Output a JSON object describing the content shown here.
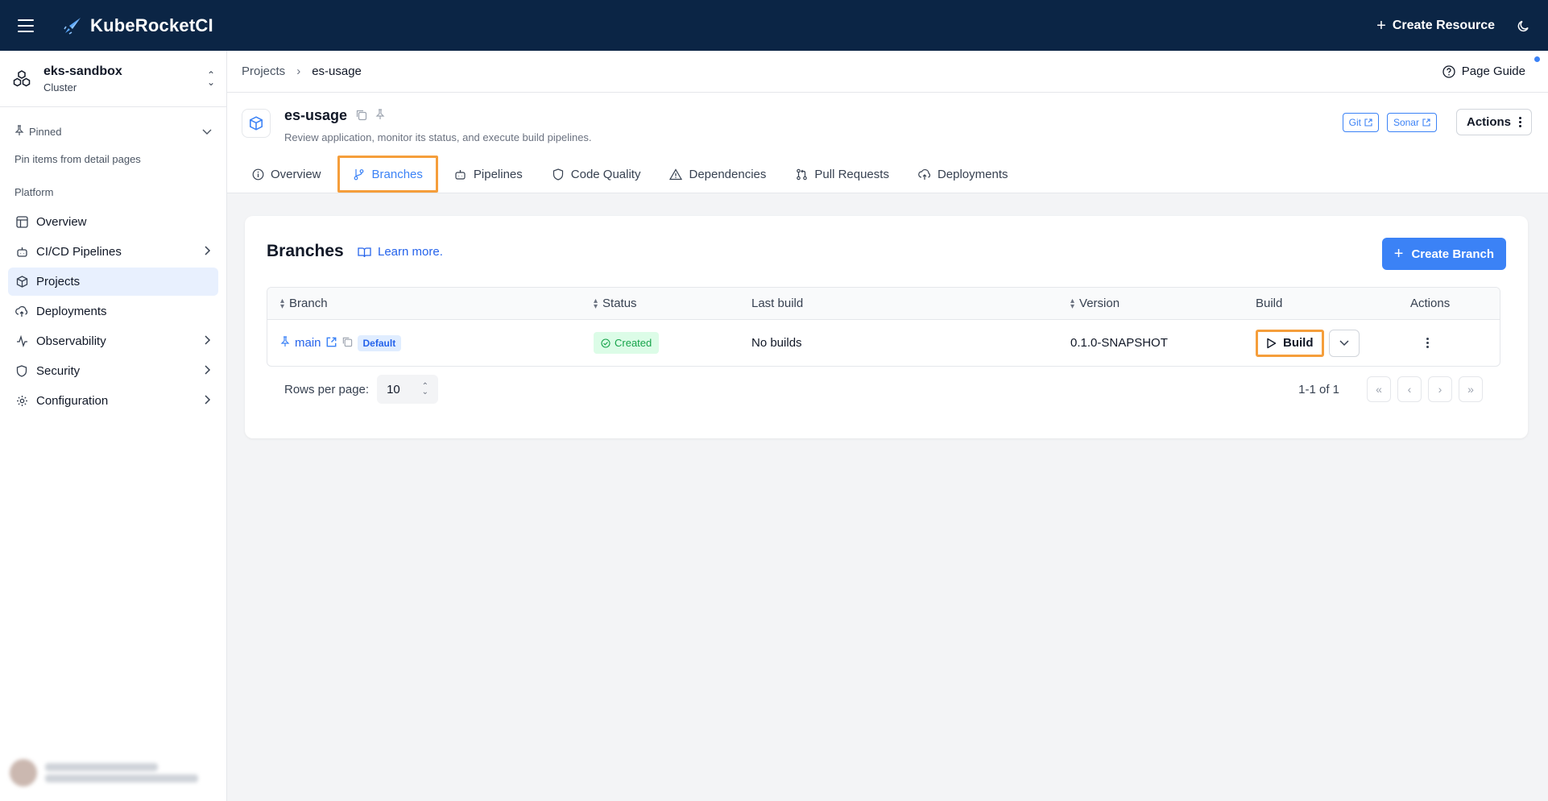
{
  "app": {
    "title": "KubeRocketCI",
    "create_resource": "Create Resource"
  },
  "sidebar": {
    "cluster_name": "eks-sandbox",
    "cluster_type": "Cluster",
    "pinned_label": "Pinned",
    "pinned_hint": "Pin items from detail pages",
    "section_label": "Platform",
    "items": [
      {
        "label": "Overview",
        "icon": "layout-icon",
        "has_children": false,
        "active": false
      },
      {
        "label": "CI/CD Pipelines",
        "icon": "bot-icon",
        "has_children": true,
        "active": false
      },
      {
        "label": "Projects",
        "icon": "box-icon",
        "has_children": false,
        "active": true
      },
      {
        "label": "Deployments",
        "icon": "cloud-upload-icon",
        "has_children": false,
        "active": false
      },
      {
        "label": "Observability",
        "icon": "activity-icon",
        "has_children": true,
        "active": false
      },
      {
        "label": "Security",
        "icon": "shield-icon",
        "has_children": true,
        "active": false
      },
      {
        "label": "Configuration",
        "icon": "gear-icon",
        "has_children": true,
        "active": false
      }
    ]
  },
  "breadcrumb": {
    "parent": "Projects",
    "current": "es-usage"
  },
  "page_guide": "Page Guide",
  "project": {
    "name": "es-usage",
    "description": "Review application, monitor its status, and execute build pipelines.",
    "links": [
      "Git",
      "Sonar"
    ],
    "actions_label": "Actions"
  },
  "tabs": [
    {
      "label": "Overview",
      "icon": "info-icon",
      "active": false
    },
    {
      "label": "Branches",
      "icon": "git-branch-icon",
      "active": true
    },
    {
      "label": "Pipelines",
      "icon": "bot-icon",
      "active": false
    },
    {
      "label": "Code Quality",
      "icon": "shield-icon",
      "active": false
    },
    {
      "label": "Dependencies",
      "icon": "warning-icon",
      "active": false
    },
    {
      "label": "Pull Requests",
      "icon": "git-pull-request-icon",
      "active": false
    },
    {
      "label": "Deployments",
      "icon": "cloud-upload-icon",
      "active": false
    }
  ],
  "branches": {
    "title": "Branches",
    "learn_more": "Learn more.",
    "create_button": "Create Branch",
    "columns": [
      "Branch",
      "Status",
      "Last build",
      "Version",
      "Build",
      "Actions"
    ],
    "rows": [
      {
        "branch": "main",
        "badge": "Default",
        "status": "Created",
        "last_build": "No builds",
        "version": "0.1.0-SNAPSHOT",
        "build_label": "Build"
      }
    ],
    "rows_per_page_label": "Rows per page:",
    "rows_per_page": "10",
    "range": "1-1 of 1"
  },
  "colors": {
    "topbar": "#0b2545",
    "accent": "#3b82f6",
    "highlight": "#f59e3b",
    "status_green": "#16a34a"
  }
}
